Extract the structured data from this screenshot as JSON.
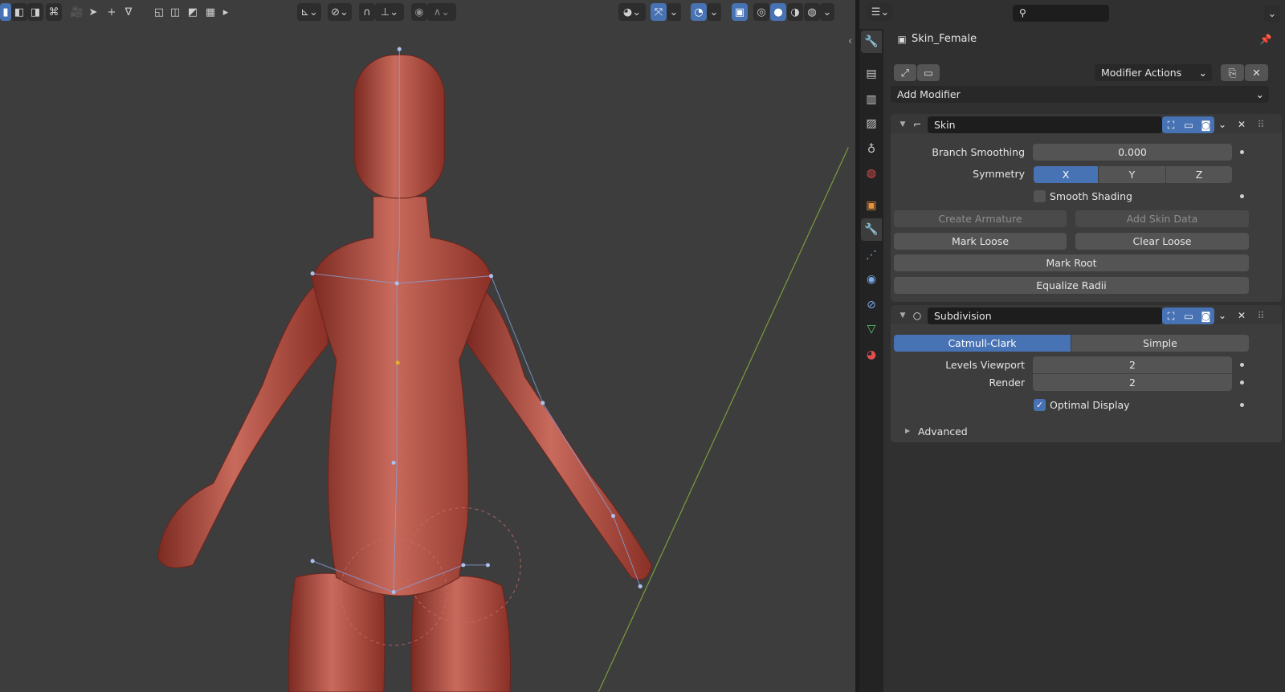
{
  "viewport": {
    "toolbar_icons": [
      "select-box-icon",
      "select-extend-icon",
      "select-subtract-icon",
      "select-invert-icon",
      "camera-icon",
      "cursor-icon",
      "add-icon",
      "mesh-vertex-icon",
      "vertex-select-icon",
      "edge-select-icon",
      "face-select-icon",
      "xray-icon",
      "play-icon",
      "transform-orientation-icon",
      "pivot-icon",
      "snap-icon",
      "snap-increment-icon",
      "proportional-edit-icon",
      "falloff-icon",
      "visibility-icon",
      "gizmo-icon",
      "overlay-icon",
      "xray-toggle-icon",
      "wireframe-shading-icon",
      "solid-shading-icon",
      "material-shading-icon",
      "rendered-shading-icon"
    ]
  },
  "properties": {
    "search_placeholder": "",
    "object_name": "Skin_Female",
    "modifier_actions": "Modifier Actions",
    "add_modifier": "Add Modifier",
    "tabs": [
      "tool",
      "render",
      "output",
      "view-layer",
      "scene",
      "world",
      "object",
      "modifiers",
      "particles",
      "physics",
      "constraints",
      "data",
      "material"
    ],
    "skin": {
      "name": "Skin",
      "branch_smoothing_label": "Branch Smoothing",
      "branch_smoothing": "0.000",
      "symmetry_label": "Symmetry",
      "symmetry": [
        {
          "label": "X",
          "on": true
        },
        {
          "label": "Y",
          "on": false
        },
        {
          "label": "Z",
          "on": false
        }
      ],
      "smooth_shading": "Smooth Shading",
      "create_armature": "Create Armature",
      "add_skin_data": "Add Skin Data",
      "mark_loose": "Mark Loose",
      "clear_loose": "Clear Loose",
      "mark_root": "Mark Root",
      "equalize_radii": "Equalize Radii"
    },
    "subdivision": {
      "name": "Subdivision",
      "catmull": "Catmull-Clark",
      "simple": "Simple",
      "levels_viewport_label": "Levels Viewport",
      "levels_viewport": "2",
      "render_label": "Render",
      "render": "2",
      "optimal_display": "Optimal Display",
      "advanced": "Advanced"
    }
  },
  "colors": {
    "accent": "#4772b3",
    "skin": "#b04a3c",
    "viewport_bg": "#3d3d3d"
  }
}
